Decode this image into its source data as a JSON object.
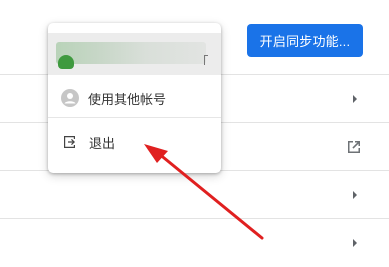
{
  "header": {
    "sync_button_label": "开启同步功能..."
  },
  "menu": {
    "other_account_label": "使用其他帐号",
    "logout_label": "退出"
  },
  "icons": {
    "person": "person-icon",
    "logout": "logout-icon",
    "chevron": "chevron-right-icon",
    "external": "external-link-icon"
  },
  "colors": {
    "accent": "#1a73e8",
    "annotation_arrow": "#e02020"
  }
}
